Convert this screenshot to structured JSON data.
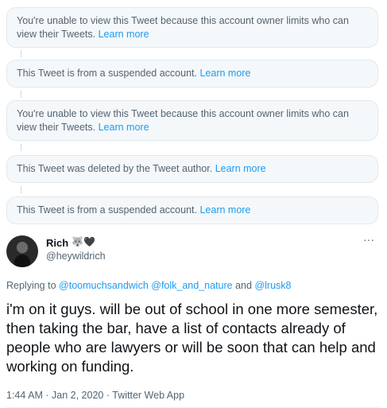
{
  "notices": [
    {
      "text": "You're unable to view this Tweet because this account owner limits who can view their Tweets.",
      "link": "Learn more"
    },
    {
      "text": "This Tweet is from a suspended account.",
      "link": "Learn more"
    },
    {
      "text": "You're unable to view this Tweet because this account owner limits who can view their Tweets.",
      "link": "Learn more"
    },
    {
      "text": "This Tweet was deleted by the Tweet author.",
      "link": "Learn more"
    },
    {
      "text": "This Tweet is from a suspended account.",
      "link": "Learn more"
    }
  ],
  "tweet": {
    "author_name": "Rich",
    "badges": "🐺🖤",
    "handle": "@heywildrich",
    "more_icon": "···",
    "replying_prefix": "Replying to",
    "mentions": [
      "@toomuchsandwich",
      "@folk_and_nature",
      "@lrusk8"
    ],
    "mention_joiner": "and",
    "text": "i'm on it guys. will be out of school in one more semester, then taking the bar, have a list of contacts already of people who are lawyers or will be soon that can help and working on funding.",
    "time": "1:44 AM",
    "date": "Jan 2, 2020",
    "source": "Twitter Web App",
    "separator": "·"
  },
  "colors": {
    "link": "#1d9bf0",
    "muted": "#536471",
    "notice_bg": "#f5f8fa"
  },
  "icons": {
    "avatar": "avatar-photo",
    "more": "more-options-icon"
  }
}
